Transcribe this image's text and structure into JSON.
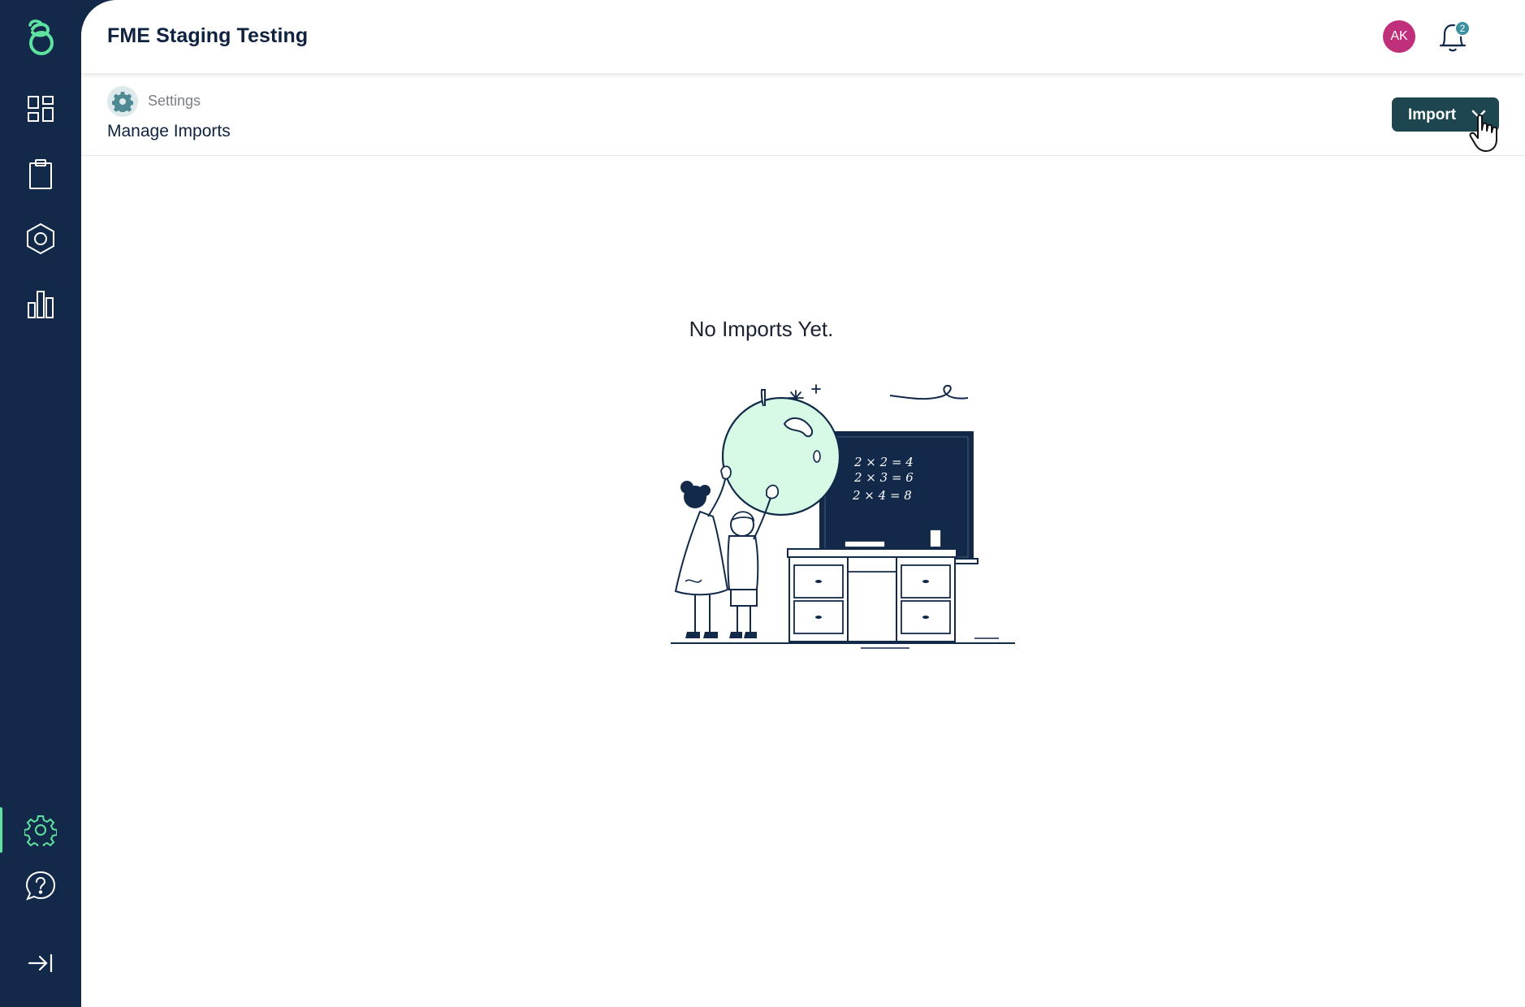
{
  "header": {
    "app_title": "FME Staging Testing",
    "avatar_initials": "AK",
    "notification_count": "2"
  },
  "breadcrumb": {
    "section": "Settings",
    "page_title": "Manage Imports"
  },
  "toolbar": {
    "import_label": "Import"
  },
  "empty_state": {
    "message": "No Imports Yet.",
    "board_lines": [
      "2 × 2 = 4",
      "2 × 3 = 6",
      "2 × 4 = 8"
    ]
  },
  "sidebar": {
    "items": [
      {
        "icon": "dashboard-icon"
      },
      {
        "icon": "clipboard-icon"
      },
      {
        "icon": "hexagon-icon"
      },
      {
        "icon": "bar-chart-icon"
      },
      {
        "icon": "gear-icon",
        "active": true
      },
      {
        "icon": "help-icon"
      },
      {
        "icon": "collapse-icon"
      }
    ]
  },
  "colors": {
    "sidebar_bg": "#12294a",
    "accent_green": "#5ee2a0",
    "button_bg": "#1e4650",
    "avatar_bg": "#c02f7a",
    "badge_bg": "#3a8fa0"
  }
}
